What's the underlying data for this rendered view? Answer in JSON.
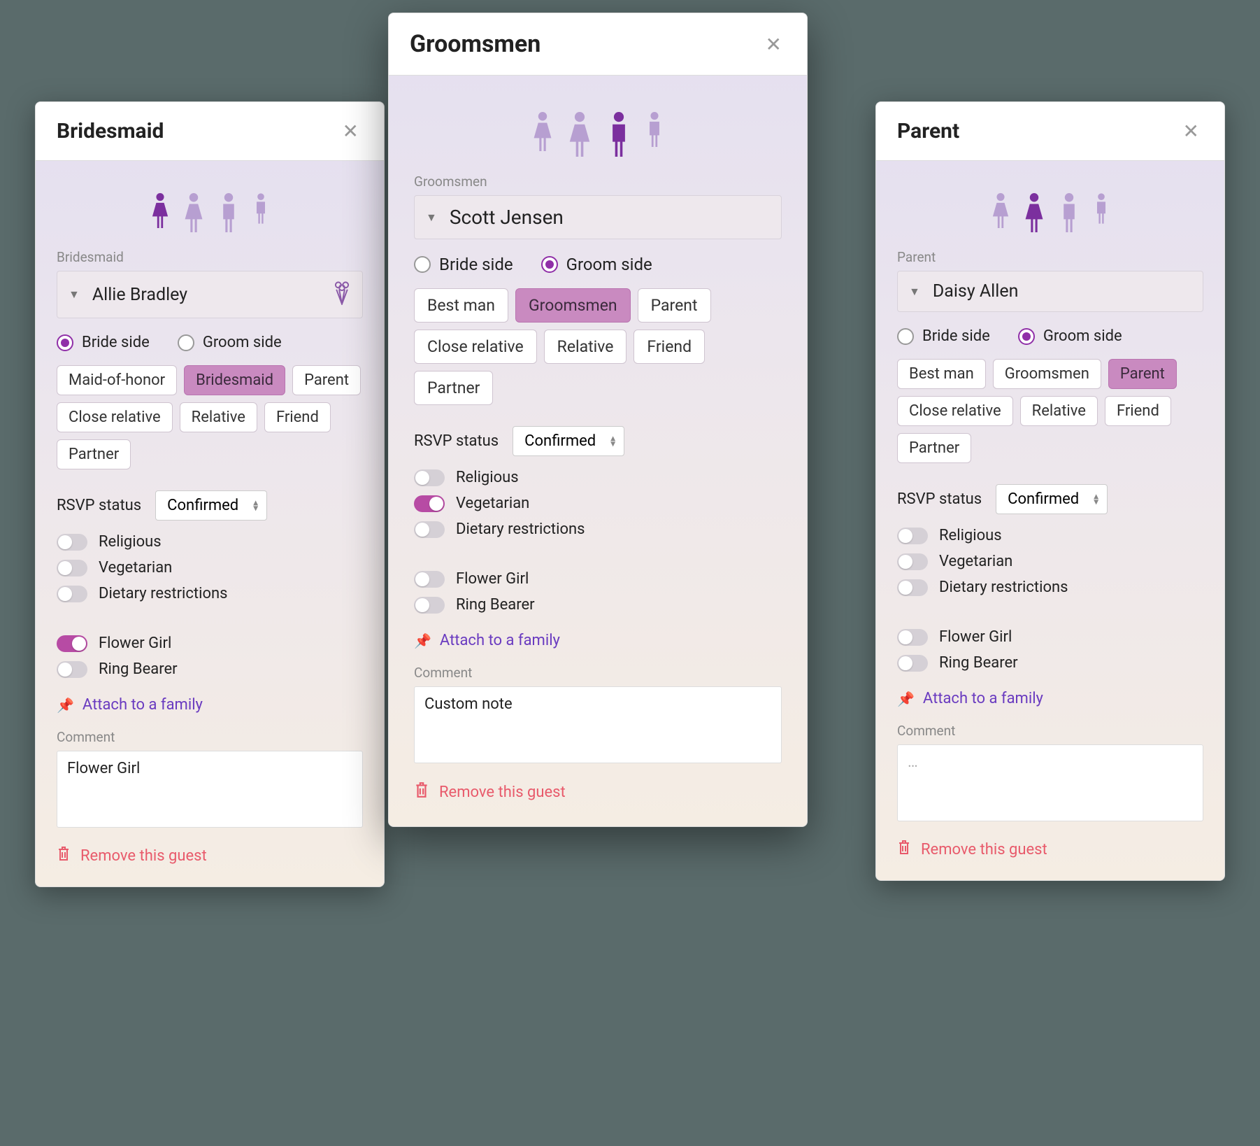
{
  "shared": {
    "side_options": {
      "bride": "Bride side",
      "groom": "Groom side"
    },
    "rsvp_label": "RSVP status",
    "rsvp_value": "Confirmed",
    "toggles": {
      "religious": "Religious",
      "vegetarian": "Vegetarian",
      "dietary": "Dietary restrictions",
      "flower_girl": "Flower Girl",
      "ring_bearer": "Ring Bearer"
    },
    "attach_label": "Attach to a family",
    "comment_label": "Comment",
    "remove_label": "Remove this guest",
    "comment_placeholder": "…"
  },
  "role_tags_bride": [
    "Maid-of-honor",
    "Bridesmaid",
    "Parent",
    "Close relative",
    "Relative",
    "Friend",
    "Partner"
  ],
  "role_tags_groom": [
    "Best man",
    "Groomsmen",
    "Parent",
    "Close relative",
    "Relative",
    "Friend",
    "Partner"
  ],
  "cards": {
    "left": {
      "title": "Bridesmaid",
      "role_label": "Bridesmaid",
      "name": "Allie Bradley",
      "has_bouquet": true,
      "side_selected": "bride",
      "role_selected": "Bridesmaid",
      "toggles_on": [
        "flower_girl"
      ],
      "comment": "Flower Girl",
      "person_selected_index": 0
    },
    "center": {
      "title": "Groomsmen",
      "role_label": "Groomsmen",
      "name": "Scott Jensen",
      "has_bouquet": false,
      "side_selected": "groom",
      "role_selected": "Groomsmen",
      "toggles_on": [
        "vegetarian"
      ],
      "comment": "Custom note",
      "person_selected_index": 2
    },
    "right": {
      "title": "Parent",
      "role_label": "Parent",
      "name": "Daisy Allen",
      "has_bouquet": false,
      "side_selected": "groom",
      "role_selected": "Parent",
      "toggles_on": [],
      "comment": "",
      "person_selected_index": 1
    }
  }
}
